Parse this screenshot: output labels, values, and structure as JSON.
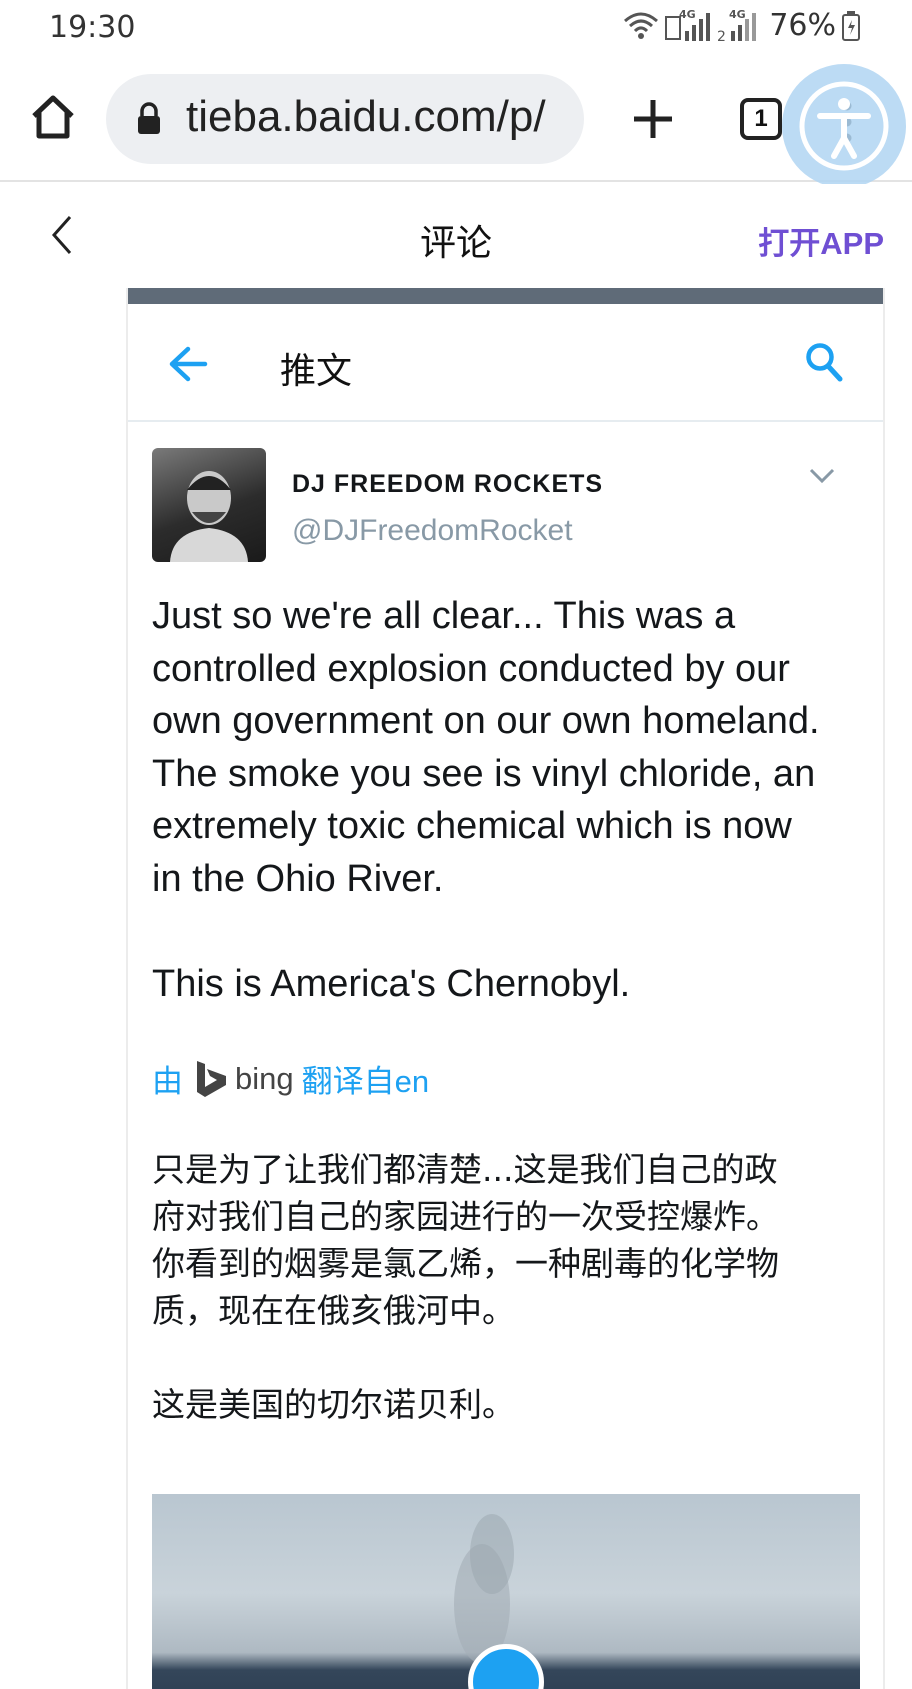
{
  "status_bar": {
    "time": "19:30",
    "battery": "76%",
    "network_1": "4G",
    "network_2": "4G"
  },
  "browser": {
    "url": "tieba.baidu.com/p/",
    "tab_count": "1"
  },
  "header": {
    "title": "评论",
    "open_app": "打开APP"
  },
  "embedded": {
    "nav_title": "推文",
    "author_name": "DJ FREEDOM ROCKETS",
    "author_handle": "@DJFreedomRocket",
    "tweet_text": "Just so we're all clear... This was a\ncontrolled explosion conducted by our\nown government on our own homeland.\nThe smoke you see is vinyl chloride, an\nextremely toxic chemical which is now\nin the Ohio River.\n\nThis is America's Chernobyl.",
    "translate_prefix": "由",
    "translate_engine": "bing",
    "translate_suffix": "翻译自en",
    "translated_text": "只是为了让我们都清楚...这是我们自己的政\n府对我们自己的家园进行的一次受控爆炸。\n你看到的烟雾是氯乙烯，一种剧毒的化学物\n质，现在在俄亥俄河中。\n\n这是美国的切尔诺贝利。"
  },
  "colors": {
    "accent": "#6f4fd3",
    "twitter_blue": "#1da1f2",
    "handle_gray": "#8899a6"
  }
}
